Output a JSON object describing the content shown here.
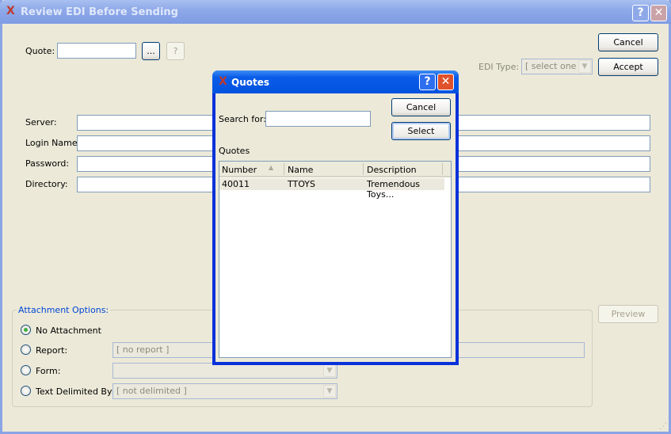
{
  "window": {
    "title": "Review EDI Before Sending",
    "help": "?",
    "close": "✕"
  },
  "quote": {
    "label": "Quote:",
    "value": "",
    "lookup": "...",
    "help": "?"
  },
  "buttons": {
    "cancel": "Cancel",
    "accept": "Accept",
    "preview": "Preview"
  },
  "edi_type": {
    "label": "EDI Type:",
    "value": "[ select one ]"
  },
  "fields": [
    {
      "label": "Server:",
      "value": ""
    },
    {
      "label": "Login Name:",
      "value": ""
    },
    {
      "label": "Password:",
      "value": ""
    },
    {
      "label": "Directory:",
      "value": ""
    }
  ],
  "attachment": {
    "legend": "Attachment Options:",
    "options": [
      {
        "label": "No Attachment",
        "selected": true
      },
      {
        "label": "Report:",
        "value": "[ no report ]"
      },
      {
        "label": "Form:",
        "value": ""
      },
      {
        "label": "Text Delimited By:",
        "value": "[ not delimited ]"
      }
    ]
  },
  "dialog": {
    "title": "Quotes",
    "help": "?",
    "close": "✕",
    "search_label": "Search for:",
    "search_value": "",
    "cancel": "Cancel",
    "select": "Select",
    "list_label": "Quotes",
    "columns": [
      "Number",
      "Name",
      "Description"
    ],
    "rows": [
      {
        "number": "40011",
        "name": "TTOYS",
        "description": "Tremendous Toys..."
      }
    ]
  },
  "colors": {
    "accent": "#0054e3",
    "legend": "#0046d5"
  }
}
